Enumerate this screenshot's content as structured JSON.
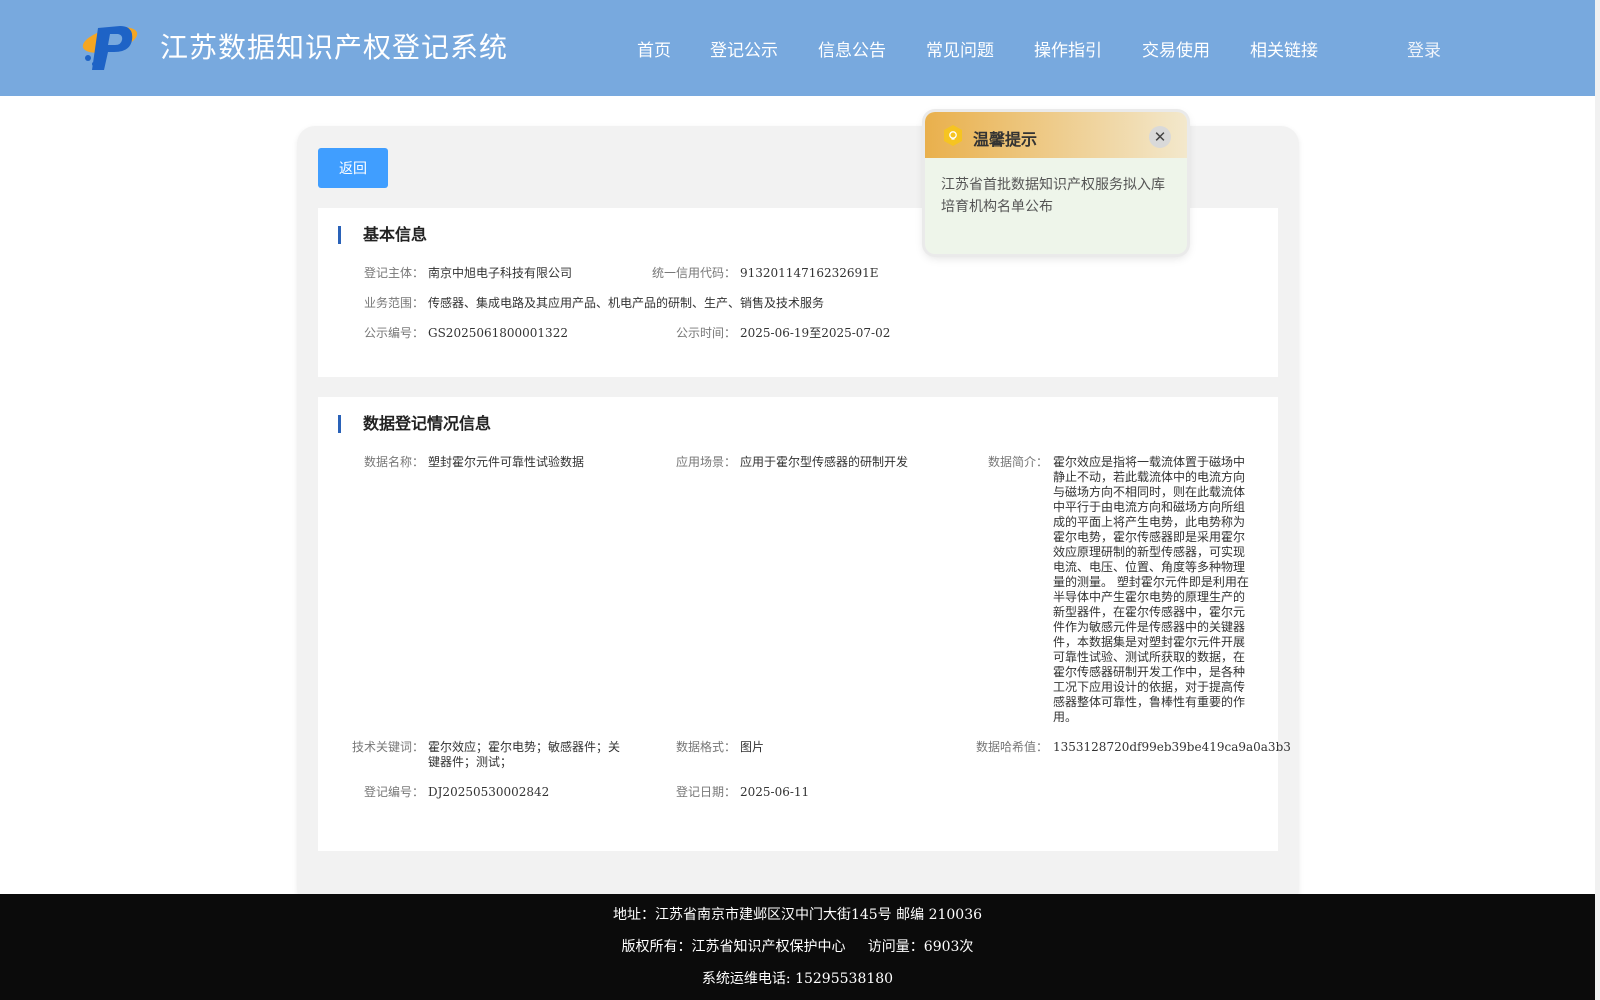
{
  "header": {
    "title": "江苏数据知识产权登记系统",
    "logo_icon": "ip-logo-icon",
    "nav": [
      {
        "label": "首页"
      },
      {
        "label": "登记公示"
      },
      {
        "label": "信息公告"
      },
      {
        "label": "常见问题"
      },
      {
        "label": "操作指引"
      },
      {
        "label": "交易使用"
      },
      {
        "label": "相关链接"
      }
    ],
    "login_label": "登录"
  },
  "back_label": "返回",
  "basic": {
    "title": "基本信息",
    "subject_label": "登记主体：",
    "subject": "南京中旭电子科技有限公司",
    "credit_label": "统一信用代码：",
    "credit": "91320114716232691E",
    "scope_label": "业务范围：",
    "scope": "传感器、集成电路及其应用产品、机电产品的研制、生产、销售及技术服务",
    "pub_no_label": "公示编号：",
    "pub_no": "GS2025061800001322",
    "pub_time_label": "公示时间：",
    "pub_time": "2025-06-19至2025-07-02"
  },
  "data_reg": {
    "title": "数据登记情况信息",
    "name_label": "数据名称：",
    "name": "塑封霍尔元件可靠性试验数据",
    "scene_label": "应用场景：",
    "scene": "应用于霍尔型传感器的研制开发",
    "intro_label": "数据简介：",
    "intro": "霍尔效应是指将一载流体置于磁场中静止不动，若此载流体中的电流方向与磁场方向不相同时，则在此载流体中平行于由电流方向和磁场方向所组成的平面上将产生电势，此电势称为霍尔电势，霍尔传感器即是采用霍尔效应原理研制的新型传感器，可实现电流、电压、位置、角度等多种物理量的测量。 塑封霍尔元件即是利用在半导体中产生霍尔电势的原理生产的新型器件，在霍尔传感器中，霍尔元件作为敏感元件是传感器中的关键器件，本数据集是对塑封霍尔元件开展可靠性试验、测试所获取的数据，在霍尔传感器研制开发工作中，是各种工况下应用设计的依据，对于提高传感器整体可靠性，鲁棒性有重要的作用。",
    "keywords_label": "技术关键词：",
    "keywords": "霍尔效应；霍尔电势；敏感器件；关键器件；测试；",
    "format_label": "数据格式：",
    "format": "图片",
    "hash_label": "数据哈希值：",
    "hash": "1353128720df99eb39be419ca9a0a3b3",
    "reg_no_label": "登记编号：",
    "reg_no": "DJ20250530002842",
    "reg_date_label": "登记日期：",
    "reg_date": "2025-06-11"
  },
  "popup": {
    "title": "温馨提示",
    "icon": "lightbulb-icon",
    "close_icon": "close-icon",
    "close_glyph": "✕",
    "message": "江苏省首批数据知识产权服务拟入库培育机构名单公布"
  },
  "footer": {
    "line1": "地址：江苏省南京市建邺区汉中门大街145号 邮编 210036",
    "line2": "版权所有：江苏省知识产权保护中心     访问量：6903次",
    "line3": "系统运维电话: 15295538180"
  },
  "colors": {
    "header_bg": "#78a9de",
    "button": "#409eff",
    "accent_bar": "#2a62b8",
    "footer_bg": "#0b0b0b"
  }
}
